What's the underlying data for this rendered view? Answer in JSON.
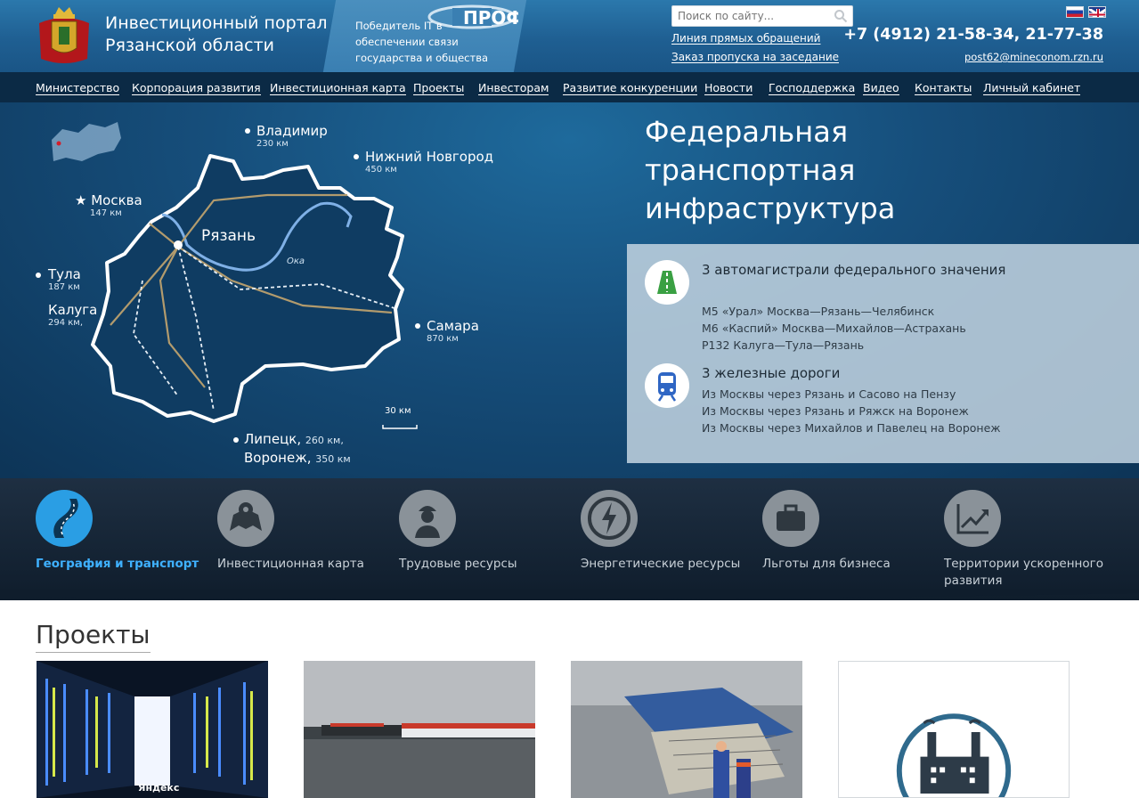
{
  "header": {
    "title": "Инвестиционный портал Рязанской области",
    "award": "Победитель IT в обеспечении связи государства и общества",
    "award_logo_text": "ПРОФ IT",
    "search_placeholder": "Поиск по сайту...",
    "link_hotline": "Линия прямых обращений",
    "link_pass": "Заказ пропуска на заседание",
    "phone": "+7 (4912) 21-58-34, 21-77-38",
    "email": "post62@mineconom.rzn.ru"
  },
  "nav": [
    "Министерство",
    "Корпорация развития",
    "Инвестиционная карта",
    "Проекты",
    "Инвесторам",
    "Развитие конкуренции",
    "Новости",
    "Господдержка",
    "Видео",
    "Контакты",
    "Личный кабинет"
  ],
  "hero": {
    "title": "Федеральная транспортная инфраструктура",
    "map": {
      "center_city": "Рязань",
      "river": "Ока",
      "scale": "30 км",
      "cities": [
        {
          "name": "Владимир",
          "dist": "230 км"
        },
        {
          "name": "Нижний Новгород",
          "dist": "450 км"
        },
        {
          "name": "Москва",
          "dist": "147 км"
        },
        {
          "name": "Тула",
          "dist": "187 км"
        },
        {
          "name": "Калуга",
          "dist": "294 км,"
        },
        {
          "name": "Самара",
          "dist": "870 км"
        },
        {
          "name": "Липецк,",
          "dist": "260 км,"
        },
        {
          "name": "Воронеж,",
          "dist": "350 км"
        }
      ]
    },
    "roads": {
      "heading": "3 автомагистрали федерального значения",
      "items": [
        "М5 «Урал» Москва—Рязань—Челябинск",
        "М6 «Каспий» Москва—Михайлов—Астрахань",
        "Р132 Калуга—Тула—Рязань"
      ]
    },
    "rails": {
      "heading": "3 железные дороги",
      "items": [
        "Из Москвы через Рязань и Сасово на Пензу",
        "Из Москвы через Рязань и Ряжск на Воронеж",
        "Из Москвы через Михайлов и Павелец на Воронеж"
      ]
    }
  },
  "categories": [
    {
      "label": "География и транспорт",
      "active": true
    },
    {
      "label": "Инвестиционная карта",
      "active": false
    },
    {
      "label": "Трудовые ресурсы",
      "active": false
    },
    {
      "label": "Энергетические ресурсы",
      "active": false
    },
    {
      "label": "Льготы для бизнеса",
      "active": false
    },
    {
      "label": "Территории ускоренного развития",
      "active": false
    }
  ],
  "projects": {
    "title": "Проекты",
    "card1_caption": "Яндекс"
  },
  "colors": {
    "accent": "#2a9ee4",
    "nav_bg": "#0b2a45",
    "header_bg": "#1f5f92"
  }
}
